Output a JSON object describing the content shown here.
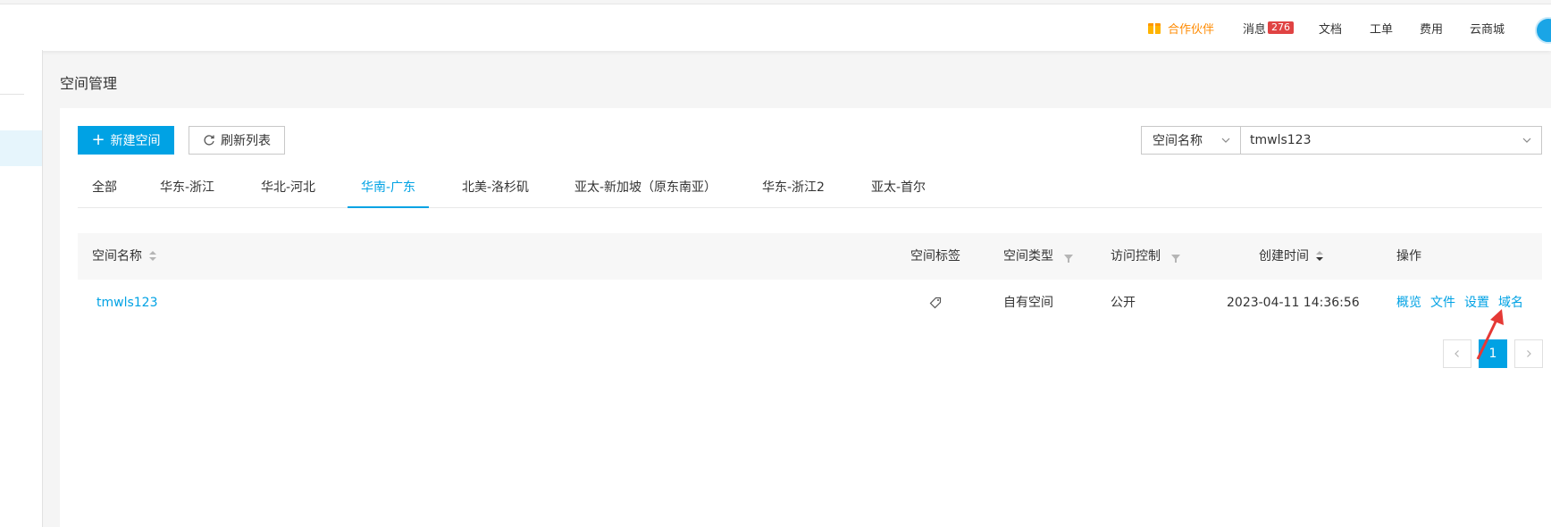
{
  "topnav": {
    "partner": "合作伙伴",
    "messages": "消息",
    "message_count": "276",
    "docs": "文档",
    "tickets": "工单",
    "billing": "费用",
    "market": "云商城"
  },
  "page": {
    "title": "空间管理"
  },
  "toolbar": {
    "new_space": "新建空间",
    "refresh": "刷新列表"
  },
  "search": {
    "type": "空间名称",
    "value": "tmwls123"
  },
  "tabs": [
    {
      "label": "全部"
    },
    {
      "label": "华东-浙江"
    },
    {
      "label": "华北-河北"
    },
    {
      "label": "华南-广东",
      "active": true
    },
    {
      "label": "北美-洛杉矶"
    },
    {
      "label": "亚太-新加坡（原东南亚）"
    },
    {
      "label": "华东-浙江2"
    },
    {
      "label": "亚太-首尔"
    }
  ],
  "table": {
    "headers": {
      "name": "空间名称",
      "tags": "空间标签",
      "type": "空间类型",
      "access": "访问控制",
      "created": "创建时间",
      "ops": "操作"
    },
    "rows": [
      {
        "name": "tmwls123",
        "tag_icon": "tag-icon",
        "type": "自有空间",
        "access": "公开",
        "created": "2023-04-11 14:36:56",
        "ops": [
          "概览",
          "文件",
          "设置",
          "域名"
        ]
      }
    ]
  },
  "pagination": {
    "current": "1"
  },
  "colors": {
    "primary": "#00a2e4",
    "partner": "#ff8a00",
    "badge": "#e04343",
    "annotation": "#e53935"
  }
}
